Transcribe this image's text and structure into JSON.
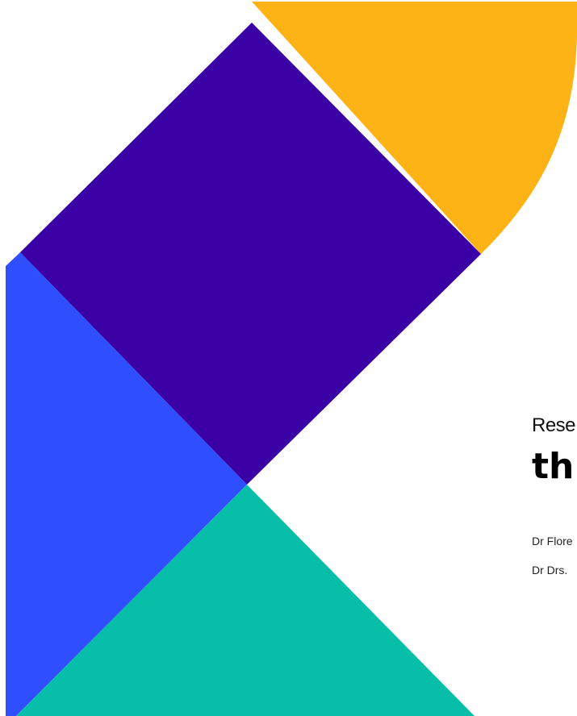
{
  "cover": {
    "title_line_1": "Rese",
    "title_line_2": "th",
    "authors": [
      "Dr Flore",
      "Dr Drs."
    ]
  },
  "colors": {
    "yellow": "#FDB316",
    "purple": "#3A00A6",
    "blue": "#2F4FFF",
    "teal": "#07BFA8",
    "background": "#FFFFFF"
  }
}
